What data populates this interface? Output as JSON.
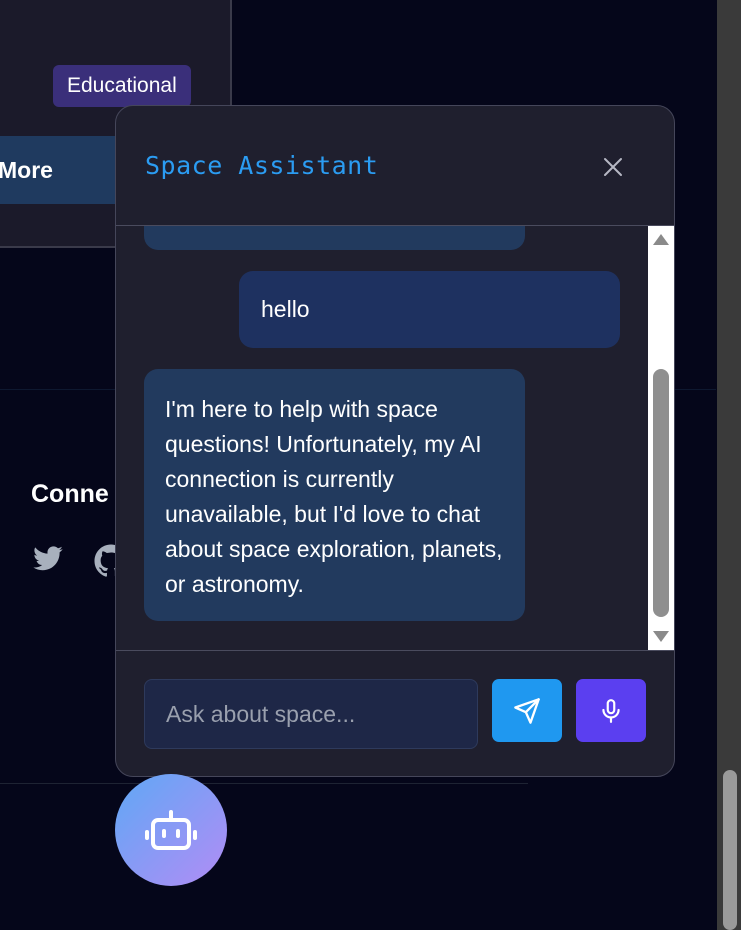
{
  "background": {
    "badge_label": "Educational",
    "more_button_label": "More",
    "connect_heading": "Conne"
  },
  "chat": {
    "title": "Space Assistant",
    "messages": [
      {
        "role": "user",
        "text": "hello"
      },
      {
        "role": "assistant",
        "text": "I'm here to help with space questions! Unfortunately, my AI connection is currently unavailable, but I'd love to chat about space exploration, planets, or astronomy."
      }
    ],
    "input_placeholder": "Ask about space...",
    "input_value": ""
  },
  "icons": {
    "close": "close-icon",
    "send": "paper-plane-icon",
    "mic": "microphone-icon",
    "bot": "robot-icon",
    "twitter": "twitter-icon",
    "github": "github-icon"
  },
  "colors": {
    "title": "#2b9cf2",
    "send_button": "#1f98f0",
    "mic_button": "#5b3ff0",
    "user_bubble": "#1e3160",
    "bot_bubble": "#223a5e",
    "launcher_gradient_start": "#5fa8f5",
    "launcher_gradient_end": "#b28cf5"
  }
}
